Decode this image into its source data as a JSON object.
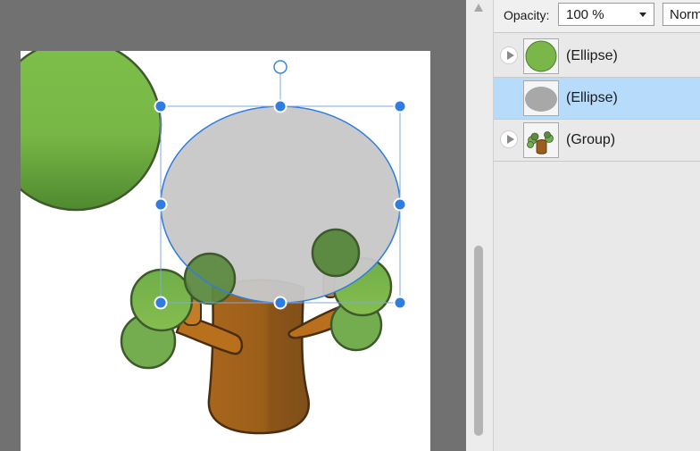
{
  "toolbar": {
    "opacity_label": "Opacity:",
    "opacity_value": "100 %",
    "blend_mode_value": "Normal"
  },
  "layers": [
    {
      "name": "(Ellipse)",
      "expandable": true,
      "selected": false,
      "thumbnail": "green-ellipse"
    },
    {
      "name": "(Ellipse)",
      "expandable": false,
      "selected": true,
      "thumbnail": "gray-ellipse"
    },
    {
      "name": "(Group)",
      "expandable": true,
      "selected": false,
      "thumbnail": "tree-group"
    }
  ],
  "colors": {
    "canvas_background": "#717171",
    "artboard": "#ffffff",
    "selection_accent": "#2f7de1",
    "selected_layer_row": "#b7dbfb",
    "foliage_green": "#7ab648",
    "trunk_brown": "#a0611a",
    "placeholder_gray": "#c8c8c8"
  },
  "icons": {
    "expand": "triangle-right-icon",
    "rotate_handle": "rotation-handle-icon",
    "scroll_up": "arrow-up-icon"
  }
}
